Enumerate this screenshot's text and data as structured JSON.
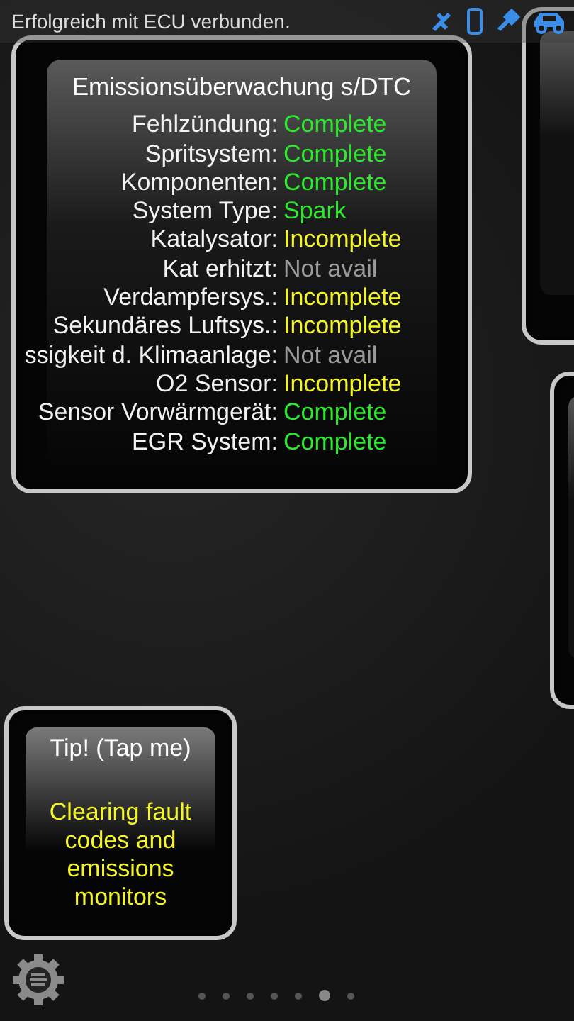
{
  "status_bar": {
    "message": "Erfolgreich mit ECU verbunden."
  },
  "monitor_card": {
    "title": "Emissionsüberwachung s/DTC",
    "rows": [
      {
        "label": "Fehlzündung:",
        "value": "Complete",
        "kind": "complete"
      },
      {
        "label": "Spritsystem:",
        "value": "Complete",
        "kind": "complete"
      },
      {
        "label": "Komponenten:",
        "value": "Complete",
        "kind": "complete"
      },
      {
        "label": "System Type:",
        "value": "Spark",
        "kind": "complete"
      },
      {
        "label": "Katalysator:",
        "value": "Incomplete",
        "kind": "incomplete"
      },
      {
        "label": "Kat erhitzt:",
        "value": "Not avail",
        "kind": "unavailable"
      },
      {
        "label": "Verdampfersys.:",
        "value": "Incomplete",
        "kind": "incomplete"
      },
      {
        "label": "Sekundäres Luftsys.:",
        "value": "Incomplete",
        "kind": "incomplete"
      },
      {
        "label": "ssigkeit d. Klimaanlage:",
        "value": "Not avail",
        "kind": "unavailable"
      },
      {
        "label": "O2 Sensor:",
        "value": "Incomplete",
        "kind": "incomplete"
      },
      {
        "label": "Sensor Vorwärmgerät:",
        "value": "Complete",
        "kind": "complete"
      },
      {
        "label": "EGR System:",
        "value": "Complete",
        "kind": "complete"
      }
    ]
  },
  "tip_card": {
    "title": "Tip! (Tap me)",
    "text": "Clearing fault codes and emissions monitors"
  },
  "page_dots": [
    {
      "selected": false
    },
    {
      "selected": false
    },
    {
      "selected": false
    },
    {
      "selected": false
    },
    {
      "selected": false
    },
    {
      "selected": true
    },
    {
      "selected": false
    }
  ]
}
